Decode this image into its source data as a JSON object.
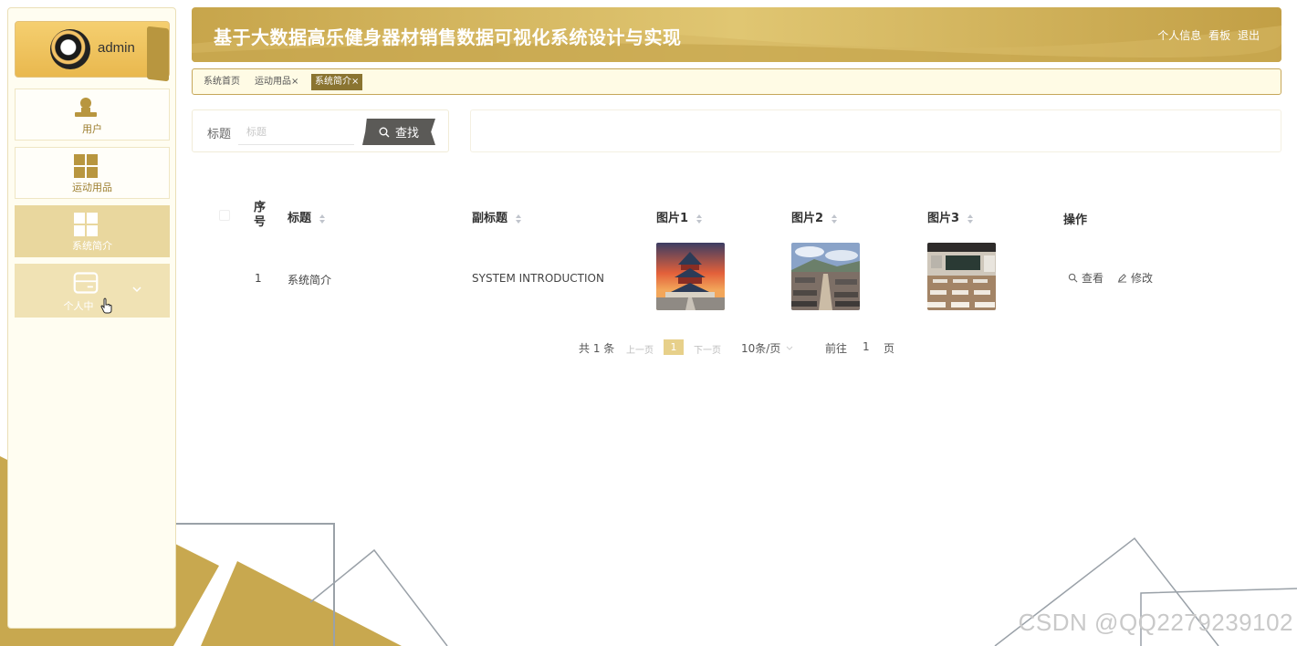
{
  "sidebar": {
    "user_name": "admin",
    "items": [
      {
        "label": "用户"
      },
      {
        "label": "运动用品"
      },
      {
        "label": "系统简介"
      },
      {
        "label": "个人中"
      }
    ]
  },
  "header": {
    "title": "基于大数据高乐健身器材销售数据可视化系统设计与实现",
    "links": [
      "个人信息",
      "看板",
      "退出"
    ]
  },
  "tabs": [
    {
      "label": "系统首页"
    },
    {
      "label": "运动用品×"
    },
    {
      "label": "系统简介×"
    }
  ],
  "search": {
    "label": "标题",
    "placeholder": "标题",
    "button": "查找"
  },
  "table": {
    "columns": [
      "序号",
      "标题",
      "副标题",
      "图片1",
      "图片2",
      "图片3",
      "操作"
    ],
    "rows": [
      {
        "index": "1",
        "title": "系统简介",
        "subtitle": "SYSTEM INTRODUCTION"
      }
    ],
    "actions": [
      "查看",
      "修改"
    ]
  },
  "pagination": {
    "total": "共 1 条",
    "prev": "上一页",
    "current": "1",
    "next": "下一页",
    "page_size": "10条/页",
    "goto_label": "前往",
    "goto_value": "1",
    "page_suffix": "页"
  },
  "watermark": "CSDN @QQ2279239102",
  "colors": {
    "gold": "#c8a84f",
    "tab_active": "#8a7431",
    "sidebar_active": "#e9d79e"
  }
}
